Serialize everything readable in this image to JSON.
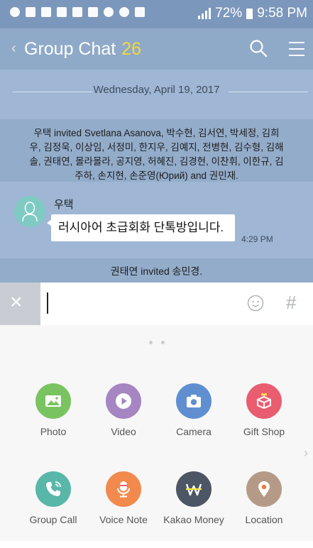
{
  "status_bar": {
    "battery": "72%",
    "time": "9:58 PM"
  },
  "header": {
    "back_label": "‹",
    "title": "Group Chat",
    "member_count": "26"
  },
  "chat": {
    "date_divider": "Wednesday, April 19, 2017",
    "system_message_1": "우택 invited Svetlana Asanova, 박수현, 김서연, 박세정, 김희우, 김정욱, 이상임, 서정미, 한지우, 김예지, 전병현, 김수형, 김해솔, 권태연, 몰라몰라, 공지영, 허혜진, 김경현, 이찬휘, 이한규, 김주하, 손지현, 손준영(Юрий) and 권민재.",
    "message": {
      "sender": "우택",
      "text": "러시아어 초급회화 단톡방입니다.",
      "time": "4:29 PM"
    },
    "system_message_2": "권태연 invited 송민경."
  },
  "input": {
    "value": "",
    "close_label": "×",
    "hash_label": "#"
  },
  "tray": {
    "items": [
      {
        "label": "Photo",
        "color": "#79c460",
        "icon": "photo-icon"
      },
      {
        "label": "Video",
        "color": "#a585c2",
        "icon": "play-icon"
      },
      {
        "label": "Camera",
        "color": "#5f8fd0",
        "icon": "camera-icon"
      },
      {
        "label": "Gift Shop",
        "color": "#ea5d70",
        "icon": "gift-icon"
      },
      {
        "label": "Group Call",
        "color": "#58b7a8",
        "icon": "phone-icon"
      },
      {
        "label": "Voice Note",
        "color": "#f28a4d",
        "icon": "microphone-icon"
      },
      {
        "label": "Kakao Money",
        "color": "#4c5664",
        "icon": "won-icon"
      },
      {
        "label": "Location",
        "color": "#b59b87",
        "icon": "location-pin-icon"
      }
    ],
    "next_label": "›"
  }
}
